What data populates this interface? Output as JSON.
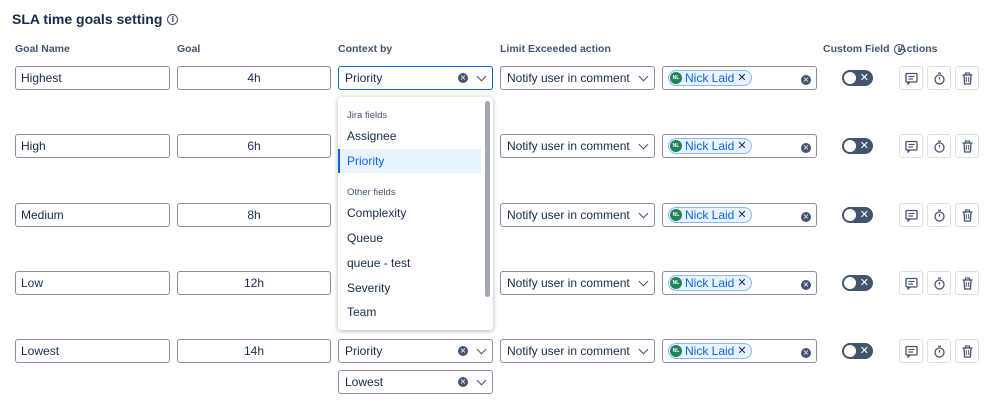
{
  "title": "SLA time goals setting",
  "info_icon": "info-icon",
  "columns": {
    "goal_name": "Goal Name",
    "goal": "Goal",
    "context_by": "Context by",
    "limit_action": "Limit Exceeded action",
    "custom_field": "Custom Field",
    "actions": "Actions"
  },
  "rows": [
    {
      "name": "Highest",
      "goal": "4h",
      "context": "Priority",
      "action": "Notify user in comment",
      "user": "Nick Laid",
      "initials": "NL"
    },
    {
      "name": "High",
      "goal": "6h",
      "context": "",
      "action": "Notify user in comment",
      "user": "Nick Laid",
      "initials": "NL"
    },
    {
      "name": "Medium",
      "goal": "8h",
      "context": "",
      "action": "Notify user in comment",
      "user": "Nick Laid",
      "initials": "NL"
    },
    {
      "name": "Low",
      "goal": "12h",
      "context": "",
      "action": "Notify user in comment",
      "user": "Nick Laid",
      "initials": "NL"
    },
    {
      "name": "Lowest",
      "goal": "14h",
      "context": "Priority",
      "context_value": "Lowest",
      "action": "Notify user in comment",
      "user": "Nick Laid",
      "initials": "NL"
    }
  ],
  "dropdown": {
    "group1": "Jira fields",
    "group1_options": [
      "Assignee",
      "Priority"
    ],
    "selected": "Priority",
    "group2": "Other fields",
    "group2_options": [
      "Complexity",
      "Queue",
      "queue - test",
      "Severity",
      "Team"
    ]
  },
  "colors": {
    "accent": "#0c66e4",
    "toggle_off": "#44546f",
    "avatar": "#1f845a"
  },
  "action_icons": [
    "comment-icon",
    "stopwatch-icon",
    "trash-icon"
  ]
}
